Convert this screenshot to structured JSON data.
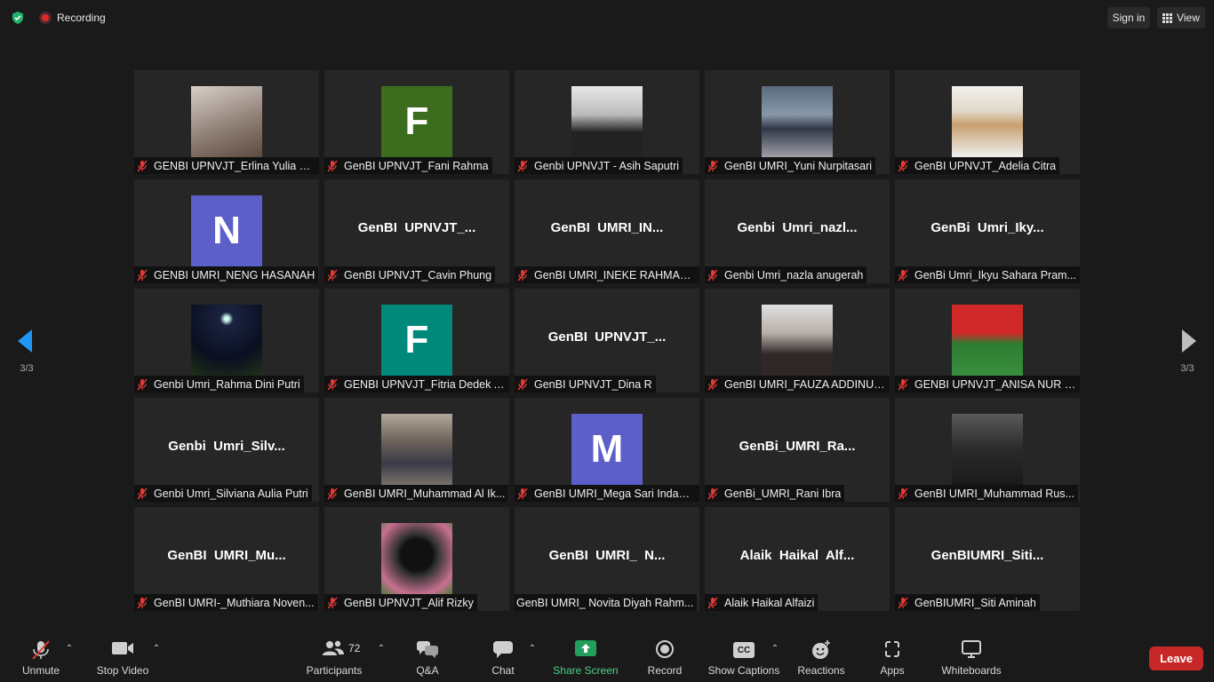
{
  "topbar": {
    "recording_label": "Recording",
    "signin_label": "Sign in",
    "view_label": "View"
  },
  "colors": {
    "avatar_purple": "#5b5fc7",
    "avatar_green_dark": "#3c6d1e",
    "avatar_teal": "#00897b",
    "leave_red": "#c62828",
    "share_green": "#22a05b"
  },
  "pagination": {
    "left": "3/3",
    "right": "3/3"
  },
  "participants": [
    {
      "label": "GENBI UPNVJT_Erlina Yulia Pu...",
      "display": "photo",
      "muted": true
    },
    {
      "label": "GenBI UPNVJT_Fani Rahma",
      "display": "letter",
      "letter": "F",
      "color": "#3c6d1e",
      "muted": true
    },
    {
      "label": "Genbi UPNVJT - Asih Saputri",
      "display": "photo",
      "muted": true
    },
    {
      "label": "GenBI UMRI_Yuni Nurpitasari",
      "display": "photo",
      "muted": true
    },
    {
      "label": "GenBI UPNVJT_Adelia Citra",
      "display": "photo",
      "muted": true
    },
    {
      "label": "GENBI UMRI_NENG HASANAH",
      "display": "letter",
      "letter": "N",
      "color": "#5b5fc7",
      "muted": true
    },
    {
      "label": "GenBI UPNVJT_Cavin Phung",
      "display": "name",
      "name": "GenBI  UPNVJT_...",
      "muted": true
    },
    {
      "label": "GenBI UMRI_INEKE RAHMADINI",
      "display": "name",
      "name": "GenBI  UMRI_IN...",
      "muted": true
    },
    {
      "label": "Genbi Umri_nazla anugerah",
      "display": "name",
      "name": "Genbi  Umri_nazl...",
      "muted": true
    },
    {
      "label": "GenBi Umri_Ikyu Sahara Pram...",
      "display": "name",
      "name": "GenBi  Umri_Iky...",
      "muted": true
    },
    {
      "label": "Genbi Umri_Rahma Dini Putri",
      "display": "photo",
      "muted": true
    },
    {
      "label": "GENBI UPNVJT_Fitria Dedek A...",
      "display": "letter",
      "letter": "F",
      "color": "#00897b",
      "muted": true
    },
    {
      "label": "GenBI UPNVJT_Dina R",
      "display": "name",
      "name": "GenBI  UPNVJT_...",
      "muted": true
    },
    {
      "label": "GenBI UMRI_FAUZA ADDINUN...",
      "display": "photo",
      "muted": true
    },
    {
      "label": "GENBI UPNVJT_ANISA NUR FI...",
      "display": "photo",
      "muted": true
    },
    {
      "label": "Genbi Umri_Silviana Aulia Putri",
      "display": "name",
      "name": "Genbi  Umri_Silv...",
      "muted": true
    },
    {
      "label": "GenBI UMRI_Muhammad Al Ik...",
      "display": "photo",
      "muted": true
    },
    {
      "label": "GenBI UMRI_Mega Sari Indah ...",
      "display": "letter",
      "letter": "M",
      "color": "#5b5fc7",
      "muted": true
    },
    {
      "label": "GenBi_UMRI_Rani Ibra",
      "display": "name",
      "name": "GenBi_UMRI_Ra...",
      "muted": true
    },
    {
      "label": "GenBI UMRI_Muhammad Rus...",
      "display": "photo",
      "muted": true
    },
    {
      "label": "GenBI UMRI-_Muthiara Noven...",
      "display": "name",
      "name": "GenBI  UMRI_Mu...",
      "muted": true
    },
    {
      "label": "GenBI UPNVJT_Alif Rizky",
      "display": "photo",
      "muted": true
    },
    {
      "label": "GenBI UMRI_ Novita Diyah Rahm...",
      "display": "name",
      "name": "GenBI  UMRI_  N...",
      "muted": false
    },
    {
      "label": "Alaik Haikal Alfaizi",
      "display": "name",
      "name": "Alaik  Haikal  Alf...",
      "muted": true
    },
    {
      "label": "GenBIUMRI_Siti Aminah",
      "display": "name",
      "name": "GenBIUMRI_Siti...",
      "muted": true
    }
  ],
  "toolbar": {
    "unmute_label": "Unmute",
    "stop_video_label": "Stop Video",
    "participants_label": "Participants",
    "participants_count": "72",
    "qa_label": "Q&A",
    "chat_label": "Chat",
    "share_label": "Share Screen",
    "record_label": "Record",
    "captions_label": "Show Captions",
    "captions_badge": "CC",
    "reactions_label": "Reactions",
    "apps_label": "Apps",
    "whiteboards_label": "Whiteboards",
    "leave_label": "Leave"
  }
}
